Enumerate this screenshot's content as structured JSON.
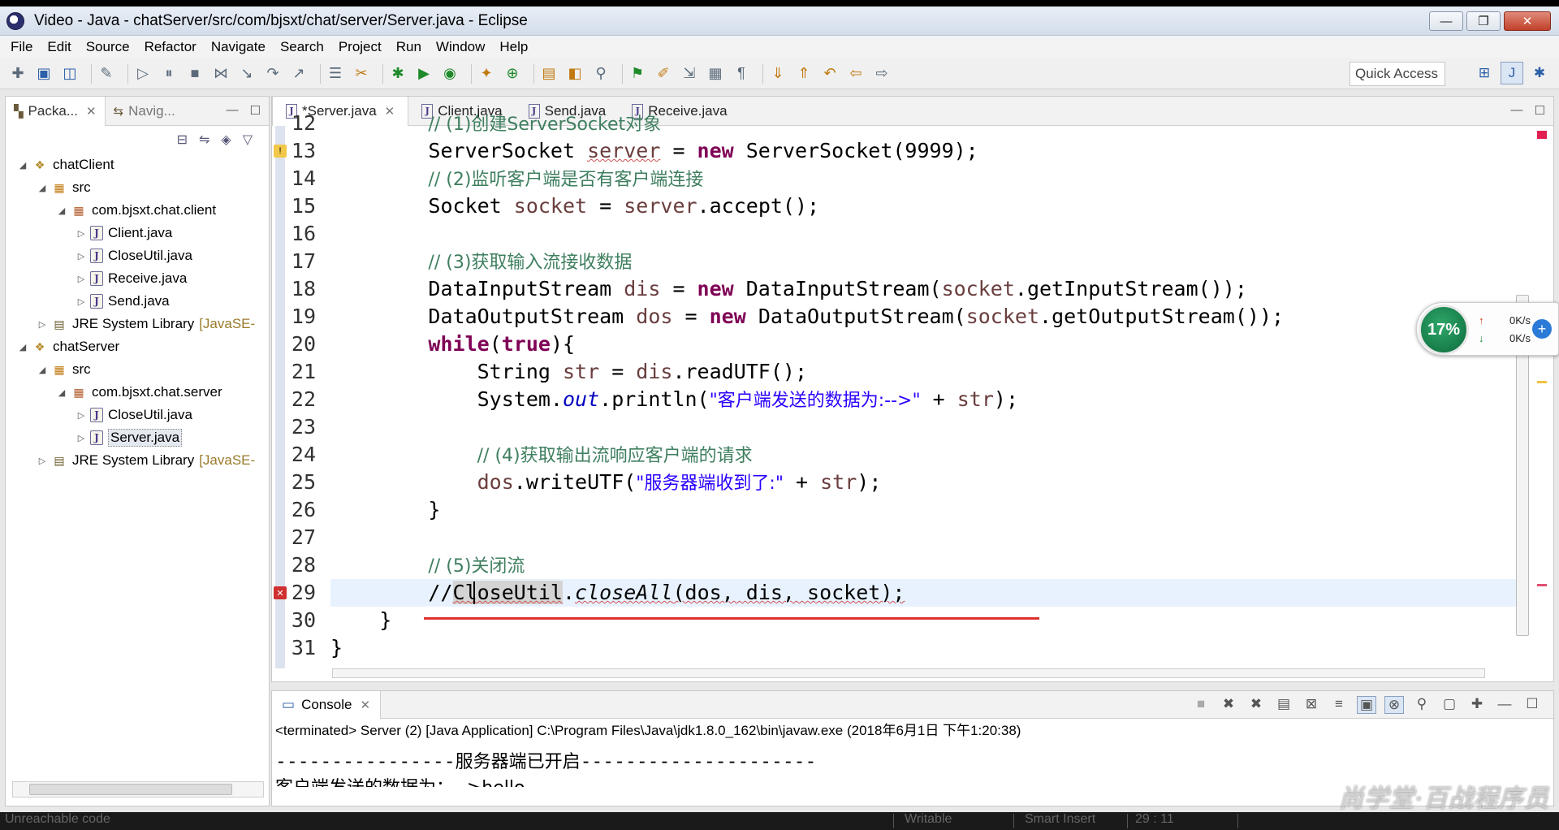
{
  "window": {
    "title": "Video - Java - chatServer/src/com/bjsxt/chat/server/Server.java - Eclipse"
  },
  "menu": [
    "File",
    "Edit",
    "Source",
    "Refactor",
    "Navigate",
    "Search",
    "Project",
    "Run",
    "Window",
    "Help"
  ],
  "toolbar": {
    "quick_access": "Quick Access"
  },
  "package_explorer": {
    "tabs": [
      "Packa...",
      "Navig..."
    ],
    "tree": [
      {
        "label": "chatClient",
        "kind": "proj",
        "depth": 0,
        "twisty": "◢"
      },
      {
        "label": "src",
        "kind": "src",
        "depth": 1,
        "twisty": "◢"
      },
      {
        "label": "com.bjsxt.chat.client",
        "kind": "pkg",
        "depth": 2,
        "twisty": "◢"
      },
      {
        "label": "Client.java",
        "kind": "java",
        "depth": 3,
        "twisty": "▷"
      },
      {
        "label": "CloseUtil.java",
        "kind": "java",
        "depth": 3,
        "twisty": "▷"
      },
      {
        "label": "Receive.java",
        "kind": "java",
        "depth": 3,
        "twisty": "▷"
      },
      {
        "label": "Send.java",
        "kind": "java",
        "depth": 3,
        "twisty": "▷"
      },
      {
        "label": "JRE System Library",
        "decor": "[JavaSE-",
        "kind": "jre",
        "depth": 1,
        "twisty": "▷"
      },
      {
        "label": "chatServer",
        "kind": "proj",
        "depth": 0,
        "twisty": "◢"
      },
      {
        "label": "src",
        "kind": "src",
        "depth": 1,
        "twisty": "◢"
      },
      {
        "label": "com.bjsxt.chat.server",
        "kind": "pkg",
        "depth": 2,
        "twisty": "◢"
      },
      {
        "label": "CloseUtil.java",
        "kind": "java",
        "depth": 3,
        "twisty": "▷"
      },
      {
        "label": "Server.java",
        "kind": "java",
        "depth": 3,
        "twisty": "▷",
        "selected": true
      },
      {
        "label": "JRE System Library",
        "decor": "[JavaSE-",
        "kind": "jre",
        "depth": 1,
        "twisty": "▷"
      }
    ]
  },
  "editor": {
    "tabs": [
      {
        "label": "*Server.java",
        "active": true
      },
      {
        "label": "Client.java"
      },
      {
        "label": "Send.java"
      },
      {
        "label": "Receive.java"
      }
    ],
    "line_numbers": [
      "12",
      "13",
      "14",
      "15",
      "16",
      "17",
      "18",
      "19",
      "20",
      "21",
      "22",
      "23",
      "24",
      "25",
      "26",
      "27",
      "28",
      "29",
      "30",
      "31"
    ],
    "current_line": "29"
  },
  "net_widget": {
    "percent": "17%",
    "up": "0K/s",
    "down": "0K/s"
  },
  "console": {
    "tab": "Console",
    "status": "<terminated> Server (2) [Java Application] C:\\Program Files\\Java\\jdk1.8.0_162\\bin\\javaw.exe (2018年6月1日 下午1:20:38)",
    "out_dashes_left": "----------------",
    "out_text": "服务器端已开启",
    "out_dashes_right": "---------------------",
    "out_line2": "客户端发送的数据为：-->hello"
  },
  "statusbar": {
    "message": "Unreachable code",
    "writable": "Writable",
    "insert": "Smart Insert",
    "position": "29 : 11"
  },
  "watermark": "尚学堂·百战程序员"
}
